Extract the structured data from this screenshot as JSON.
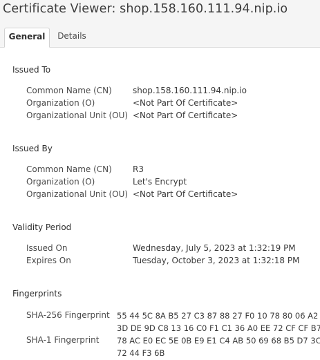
{
  "window": {
    "title": "Certificate Viewer: shop.158.160.111.94.nip.io"
  },
  "tabs": [
    {
      "label": "General",
      "active": true
    },
    {
      "label": "Details",
      "active": false
    }
  ],
  "issued_to": {
    "heading": "Issued To",
    "rows": [
      {
        "label": "Common Name (CN)",
        "value": "shop.158.160.111.94.nip.io"
      },
      {
        "label": "Organization (O)",
        "value": "<Not Part Of Certificate>"
      },
      {
        "label": "Organizational Unit (OU)",
        "value": "<Not Part Of Certificate>"
      }
    ]
  },
  "issued_by": {
    "heading": "Issued By",
    "rows": [
      {
        "label": "Common Name (CN)",
        "value": "R3"
      },
      {
        "label": "Organization (O)",
        "value": "Let's Encrypt"
      },
      {
        "label": "Organizational Unit (OU)",
        "value": "<Not Part Of Certificate>"
      }
    ]
  },
  "validity": {
    "heading": "Validity Period",
    "rows": [
      {
        "label": "Issued On",
        "value": "Wednesday, July 5, 2023 at 1:32:19 PM"
      },
      {
        "label": "Expires On",
        "value": "Tuesday, October 3, 2023 at 1:32:18 PM"
      }
    ]
  },
  "fingerprints": {
    "heading": "Fingerprints",
    "sha256": {
      "label": "SHA-256 Fingerprint",
      "line1": "55 44 5C 8A B5 27 C3 87 88 27 F0 10 78 80 06 A2",
      "line2": "3D DE 9D C8 13 16 C0 F1 C1 36 A0 EE 72 CF CF B7"
    },
    "sha1": {
      "label": "SHA-1 Fingerprint",
      "line1": "78 AC E0 EC 5E 0B E9 E1 C4 AB 50 69 68 B5 D7 3C",
      "line2": "72 44 F3 6B"
    }
  }
}
